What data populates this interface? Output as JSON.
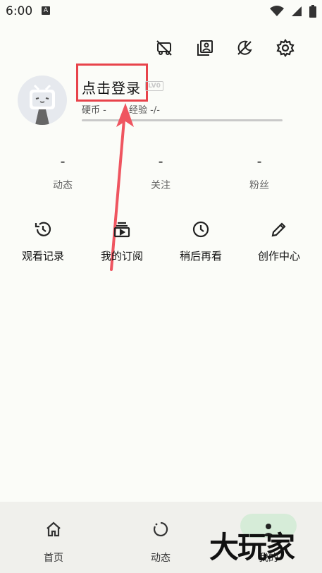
{
  "status": {
    "time": "6:00",
    "notif_glyph": "A"
  },
  "profile": {
    "login_label": "点击登录",
    "level_badge": "LV0",
    "coin_label": "硬币 -",
    "exp_label": "经验 -/-"
  },
  "stats": [
    {
      "value": "-",
      "label": "动态"
    },
    {
      "value": "-",
      "label": "关注"
    },
    {
      "value": "-",
      "label": "粉丝"
    }
  ],
  "quick_actions": [
    {
      "label": "观看记录",
      "icon": "history-icon"
    },
    {
      "label": "我的订阅",
      "icon": "subscription-icon"
    },
    {
      "label": "稍后再看",
      "icon": "clock-icon"
    },
    {
      "label": "创作中心",
      "icon": "pencil-icon"
    }
  ],
  "nav": [
    {
      "label": "首页",
      "icon": "home-icon"
    },
    {
      "label": "动态",
      "icon": "refresh-circle-icon"
    },
    {
      "label": "",
      "icon": "empty"
    },
    {
      "label": "我的",
      "icon": "person-icon"
    }
  ],
  "watermark": {
    "text": "大玩家"
  },
  "colors": {
    "accent_red": "#e8434b",
    "nav_pill": "#d6ecd8",
    "background": "#fbfcf8"
  }
}
